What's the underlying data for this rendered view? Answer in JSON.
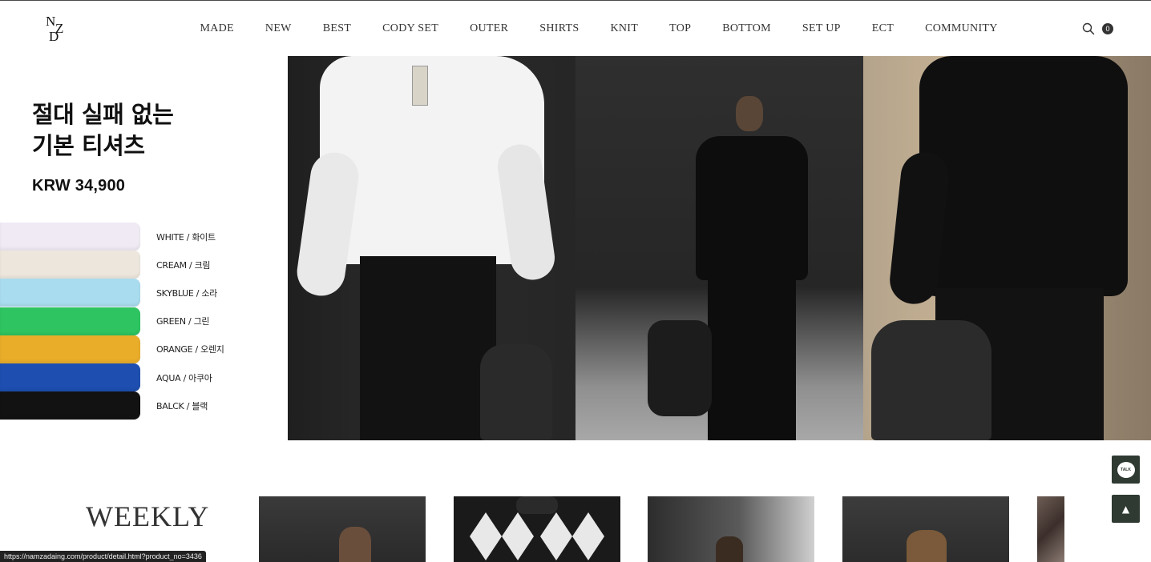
{
  "header": {
    "logo_letters": [
      "N",
      "Z",
      "D"
    ],
    "nav": [
      "MADE",
      "NEW",
      "BEST",
      "CODY SET",
      "OUTER",
      "SHIRTS",
      "KNIT",
      "TOP",
      "BOTTOM",
      "SET UP",
      "ECT",
      "COMMUNITY"
    ],
    "search_icon": "search-icon",
    "cart_count": "0"
  },
  "hero": {
    "title_line1": "절대 실패 없는",
    "title_line2": "기본 티셔츠",
    "price": "KRW 34,900",
    "colors": [
      {
        "label": "WHITE / 화이트",
        "hex": "#efeaf3"
      },
      {
        "label": "CREAM / 크림",
        "hex": "#ede6dc"
      },
      {
        "label": "SKYBLUE / 소라",
        "hex": "#a9dcef"
      },
      {
        "label": "GREEN / 그린",
        "hex": "#2dc461"
      },
      {
        "label": "ORANGE / 오렌지",
        "hex": "#e9ad2a"
      },
      {
        "label": "AQUA / 아쿠아",
        "hex": "#1e4fb0"
      },
      {
        "label": "BALCK / 블랙",
        "hex": "#121212"
      }
    ]
  },
  "weekly": {
    "title": "WEEKLY"
  },
  "floating": {
    "chat_label": "TALK",
    "top_label": "▲"
  },
  "status_url": "https://namzadaing.com/product/detail.html?product_no=3436"
}
